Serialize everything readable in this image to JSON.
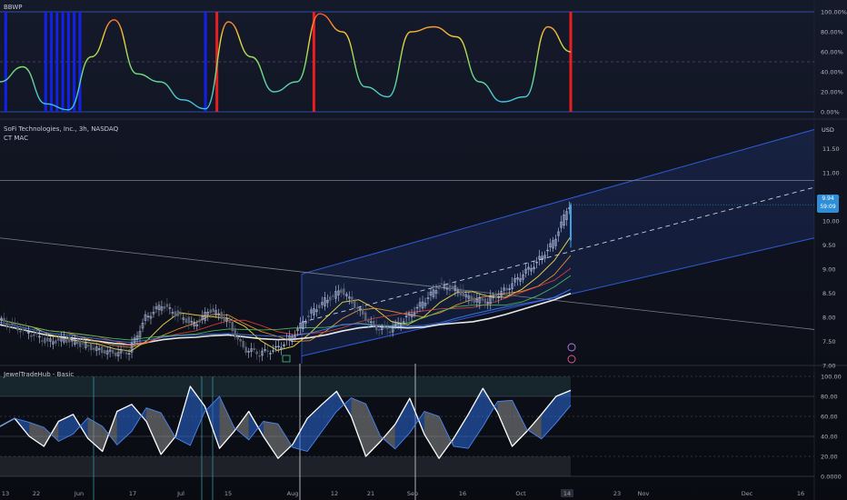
{
  "panes": {
    "bbwp": {
      "title": "BBWP",
      "axis_ticks": [
        "100.00%",
        "80.00%",
        "60.00%",
        "40.00%",
        "20.00%",
        "0.00%"
      ]
    },
    "price": {
      "title": "SoFi Technologies, Inc., 3h, NASDAQ",
      "subtitle": "CT MAC",
      "currency": "USD",
      "axis_ticks": [
        "11.50",
        "11.00",
        "10.50",
        "10.00",
        "9.50",
        "9.00",
        "8.50",
        "8.00",
        "7.50",
        "7.00"
      ],
      "last_price": "9.94",
      "countdown": "59:09"
    },
    "osc": {
      "title": "JewelTradeHub - Basic",
      "axis_ticks": [
        "100.00",
        "80.00",
        "60.00",
        "40.00",
        "20.00",
        "0.0000"
      ]
    }
  },
  "time_axis": [
    "13",
    "22",
    "Jun",
    "17",
    "Jul",
    "15",
    "Aug",
    "12",
    "21",
    "Sep",
    "16",
    "Oct",
    "14",
    "23",
    "Nov",
    "Dec",
    "16"
  ],
  "colors": {
    "background": "#0c0e15",
    "channel": "#2f5bd6",
    "bbwp_high": "#ff1f1f",
    "bbwp_low": "#1322ff",
    "price_up": "#b9c6ea",
    "osc_line": "#ffffff",
    "osc_fill_blue": "#2b6ad8",
    "osc_fill_gray": "#8e8e8e",
    "last_price_badge": "#2e8fd8"
  },
  "chart_data": [
    {
      "type": "line",
      "title": "BBWP",
      "ylim": [
        0,
        100
      ],
      "y_unit": "%",
      "x": [
        0,
        4,
        8,
        12,
        16,
        20,
        24,
        28,
        32,
        36,
        40,
        44,
        48,
        52,
        56,
        60,
        64,
        68,
        72,
        76,
        80,
        84,
        88,
        92,
        96,
        100
      ],
      "series": [
        {
          "values": [
            30,
            45,
            8,
            2,
            55,
            92,
            38,
            30,
            12,
            3,
            90,
            55,
            20,
            30,
            98,
            80,
            25,
            15,
            80,
            85,
            75,
            30,
            10,
            15,
            85,
            60
          ]
        }
      ],
      "highlight_low_bars_x": [
        1,
        8,
        9,
        10,
        11,
        12,
        13,
        14,
        36
      ],
      "highlight_high_bars_x": [
        38,
        55,
        100
      ]
    },
    {
      "type": "candlestick",
      "title": "SoFi Technologies, Inc., 3h, NASDAQ",
      "ylim": [
        6.75,
        11.75
      ],
      "y_unit": "USD",
      "x_ticks": [
        "13",
        "22",
        "Jun",
        "17",
        "Jul",
        "15",
        "Aug",
        "12",
        "21",
        "Sep",
        "16",
        "Oct",
        "14",
        "23",
        "Nov",
        "Dec",
        "16"
      ],
      "close_path": [
        7.55,
        7.4,
        7.25,
        7.1,
        7.15,
        7.05,
        6.95,
        6.85,
        6.9,
        7.6,
        7.85,
        7.65,
        7.45,
        7.75,
        7.55,
        6.95,
        6.85,
        6.95,
        7.2,
        7.65,
        7.95,
        8.15,
        7.8,
        7.4,
        7.35,
        7.6,
        7.9,
        8.25,
        8.2,
        7.95,
        7.95,
        8.15,
        8.45,
        8.75,
        9.15,
        9.94
      ],
      "last_price": 9.94,
      "regression_channel": {
        "start_x": "Aug",
        "upper_start": 8.5,
        "mid_start": 7.5,
        "lower_start": 6.8,
        "upper_end": 11.5,
        "mid_end": 10.3,
        "lower_end": 9.25
      },
      "moving_averages": [
        "white",
        "yellow",
        "orange",
        "red",
        "green",
        "blue"
      ]
    },
    {
      "type": "line",
      "title": "JewelTradeHub - Basic",
      "ylim": [
        0,
        100
      ],
      "series": [
        {
          "values": [
            50,
            58,
            40,
            30,
            55,
            62,
            38,
            25,
            65,
            72,
            55,
            22,
            40,
            90,
            70,
            28,
            45,
            65,
            40,
            18,
            32,
            58,
            72,
            85,
            60,
            20,
            35,
            52,
            78,
            42,
            18,
            38,
            62,
            88,
            64,
            30,
            45,
            62,
            80,
            86
          ]
        }
      ],
      "levels": [
        100,
        80,
        60,
        40,
        20,
        0
      ]
    }
  ]
}
